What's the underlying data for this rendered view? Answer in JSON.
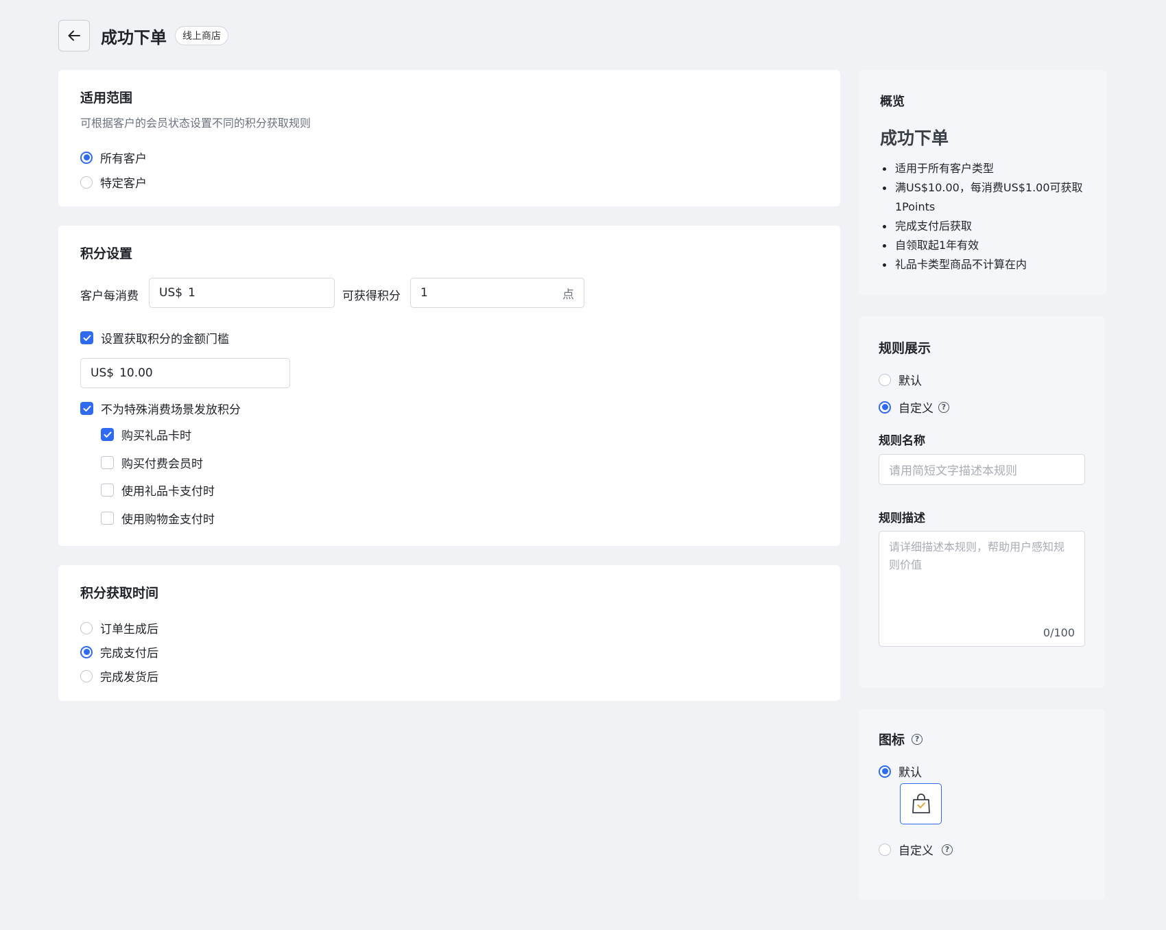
{
  "header": {
    "title": "成功下单",
    "tag": "线上商店",
    "back_icon": "arrow-left-icon"
  },
  "scope": {
    "title": "适用范围",
    "subtitle": "可根据客户的会员状态设置不同的积分获取规则",
    "options": [
      {
        "label": "所有客户",
        "selected": true
      },
      {
        "label": "特定客户",
        "selected": false
      }
    ]
  },
  "points": {
    "title": "积分设置",
    "spend_label": "客户每消费",
    "spend_prefix": "US$",
    "spend_value": "1",
    "earn_label": "可获得积分",
    "earn_value": "1",
    "earn_suffix": "点",
    "threshold_label": "设置获取积分的金额门槛",
    "threshold_checked": true,
    "threshold_prefix": "US$",
    "threshold_value": "10.00",
    "exclude_label": "不为特殊消费场景发放积分",
    "exclude_checked": true,
    "exclusions": [
      {
        "label": "购买礼品卡时",
        "checked": true
      },
      {
        "label": "购买付费会员时",
        "checked": false
      },
      {
        "label": "使用礼品卡支付时",
        "checked": false
      },
      {
        "label": "使用购物金支付时",
        "checked": false
      }
    ]
  },
  "timing": {
    "title": "积分获取时间",
    "options": [
      {
        "label": "订单生成后",
        "selected": false
      },
      {
        "label": "完成支付后",
        "selected": true
      },
      {
        "label": "完成发货后",
        "selected": false
      }
    ]
  },
  "overview": {
    "title": "概览",
    "heading": "成功下单",
    "bullets": [
      "适用于所有客户类型",
      "满US$10.00，每消费US$1.00可获取1Points",
      "完成支付后获取",
      "自领取起1年有效",
      "礼品卡类型商品不计算在内"
    ]
  },
  "rule_display": {
    "title": "规则展示",
    "option_default": "默认",
    "option_custom": "自定义",
    "selected": "custom",
    "name_label": "规则名称",
    "name_placeholder": "请用简短文字描述本规则",
    "desc_label": "规则描述",
    "desc_placeholder": "请详细描述本规则，帮助用户感知规则价值",
    "desc_count": "0/100"
  },
  "icon_section": {
    "title": "图标",
    "option_default": "默认",
    "option_custom": "自定义",
    "selected": "default",
    "preview_icon": "shopping-bag-check-icon"
  },
  "colors": {
    "accent": "#2f6bf0",
    "background": "#f1f2f6",
    "bag_check": "#e8a23a"
  }
}
